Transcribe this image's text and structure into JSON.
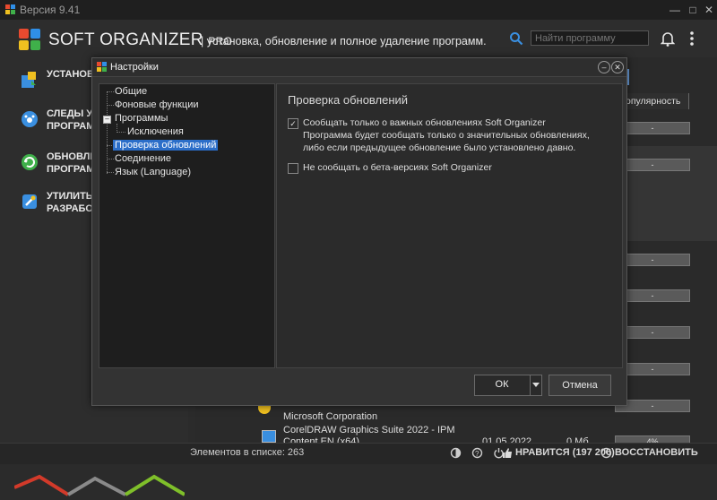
{
  "window": {
    "title": "Версия 9.41"
  },
  "header": {
    "brand": "SOFT ORGANIZER",
    "brand_suffix": "PRO",
    "tagline": "| установка, обновление и полное удаление программ.",
    "search_placeholder": "Найти программу"
  },
  "sidebar": {
    "items": [
      {
        "label": "УСТАНОВ",
        "icon": "install-icon"
      },
      {
        "label": "СЛЕДЫ УЖ\nПРОГРАМ",
        "icon": "traces-icon"
      },
      {
        "label": "ОБНОВЛЕ\nПРОГРАМ",
        "icon": "update-icon"
      },
      {
        "label": "УТИЛИТЫ\nРАЗРАБОТ",
        "icon": "utilities-icon"
      }
    ]
  },
  "main": {
    "column_header": "опулярность",
    "popularity_placeholder": "-",
    "popularity_value": "4%",
    "list_text": [
      "Microsoft Corporation",
      "CorelDRAW Graphics Suite 2022 - IPM",
      "Content EN (x64)"
    ],
    "partial_date": "01.05.2022",
    "partial_size": "0 Мб"
  },
  "status": {
    "count": "Элементов в списке: 263",
    "like": "НРАВИТСЯ (197 206)",
    "restore": "ВОССТАНОВИТЬ"
  },
  "dialog": {
    "title": "Настройки",
    "tree": [
      "Общие",
      "Фоновые функции",
      "Программы",
      "Исключения",
      "Проверка обновлений",
      "Соединение",
      "Язык (Language)"
    ],
    "selected": "Проверка обновлений",
    "heading": "Проверка обновлений",
    "options": [
      {
        "checked": true,
        "text": "Сообщать только о важных обновлениях Soft Organizer\nПрограмма будет сообщать только о значительных обновлениях,\nлибо если предыдущее обновление было установлено давно."
      },
      {
        "checked": false,
        "text": "Не сообщать о бета-версиях Soft Organizer"
      }
    ],
    "ok_label": "ОК",
    "cancel_label": "Отмена"
  },
  "colors": {
    "selection": "#2b6ec9",
    "graph_red": "#d23a2a",
    "graph_gray": "#8a8a8a",
    "graph_green": "#7fbf2a"
  }
}
